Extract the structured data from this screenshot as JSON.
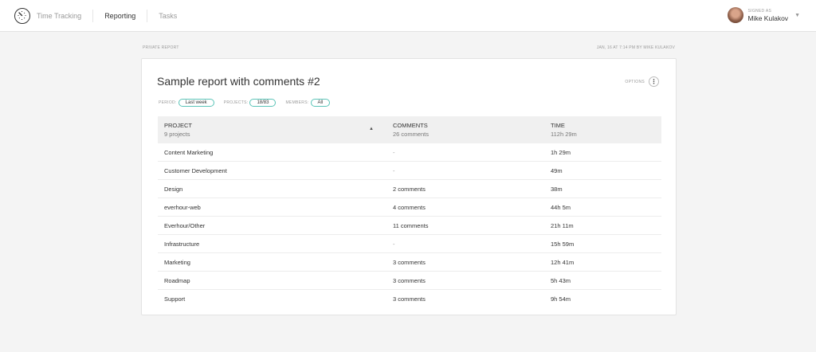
{
  "nav": {
    "items": [
      {
        "label": "Time Tracking",
        "active": false
      },
      {
        "label": "Reporting",
        "active": true
      },
      {
        "label": "Tasks",
        "active": false
      }
    ]
  },
  "user": {
    "signed_as": "SIGNED AS",
    "name": "Mike Kulakov"
  },
  "report": {
    "privacy": "PRIVATE REPORT",
    "updated": "JAN, 16 AT 7:14 PM BY MIKE KULAKOV",
    "title": "Sample report with comments #2",
    "options_label": "OPTIONS",
    "filters": {
      "period_label": "PERIOD:",
      "period_value": "Last week",
      "projects_label": "PROJECTS:",
      "projects_value": "18/83",
      "members_label": "MEMBERS:",
      "members_value": "All"
    }
  },
  "table": {
    "columns": [
      {
        "title": "PROJECT",
        "sub": "9 projects"
      },
      {
        "title": "COMMENTS",
        "sub": "26 comments"
      },
      {
        "title": "TIME",
        "sub": "112h 29m"
      }
    ],
    "rows": [
      {
        "project": "Content Marketing",
        "comments": "-",
        "time": "1h 29m"
      },
      {
        "project": "Customer Development",
        "comments": "-",
        "time": "49m"
      },
      {
        "project": "Design",
        "comments": "2 comments",
        "time": "38m"
      },
      {
        "project": "everhour-web",
        "comments": "4 comments",
        "time": "44h 5m"
      },
      {
        "project": "Everhour/Other",
        "comments": "11 comments",
        "time": "21h 11m"
      },
      {
        "project": "Infrastructure",
        "comments": "-",
        "time": "15h 59m"
      },
      {
        "project": "Marketing",
        "comments": "3 comments",
        "time": "12h 41m"
      },
      {
        "project": "Roadmap",
        "comments": "3 comments",
        "time": "5h 43m"
      },
      {
        "project": "Support",
        "comments": "3 comments",
        "time": "9h 54m"
      }
    ]
  }
}
